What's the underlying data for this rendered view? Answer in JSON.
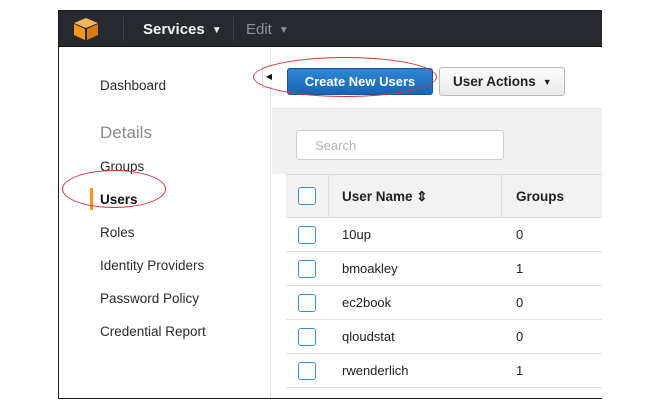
{
  "topbar": {
    "services_label": "Services",
    "edit_label": "Edit",
    "caret": "▼",
    "logo_color": "#f7981d"
  },
  "sidebar": {
    "dashboard": "Dashboard",
    "details_header": "Details",
    "items": [
      {
        "label": "Groups"
      },
      {
        "label": "Users",
        "active": true
      },
      {
        "label": "Roles"
      },
      {
        "label": "Identity Providers"
      },
      {
        "label": "Password Policy"
      },
      {
        "label": "Credential Report"
      }
    ],
    "collapse_glyph": "◀"
  },
  "toolbar": {
    "create_label": "Create New Users",
    "actions_label": "User Actions",
    "actions_caret": "▼"
  },
  "search": {
    "placeholder": "Search",
    "value": ""
  },
  "table": {
    "columns": {
      "name": "User Name ⇕",
      "groups": "Groups"
    },
    "rows": [
      {
        "name": "10up",
        "groups": "0"
      },
      {
        "name": "bmoakley",
        "groups": "1"
      },
      {
        "name": "ec2book",
        "groups": "0"
      },
      {
        "name": "qloudstat",
        "groups": "0"
      },
      {
        "name": "rwenderlich",
        "groups": "1"
      }
    ]
  },
  "colors": {
    "topbar_bg": "#262a2e",
    "primary_button": "#1f74c6",
    "active_accent": "#f39a1e",
    "annotation_red": "#d8333a",
    "checkbox_blue": "#3f8fd6"
  }
}
